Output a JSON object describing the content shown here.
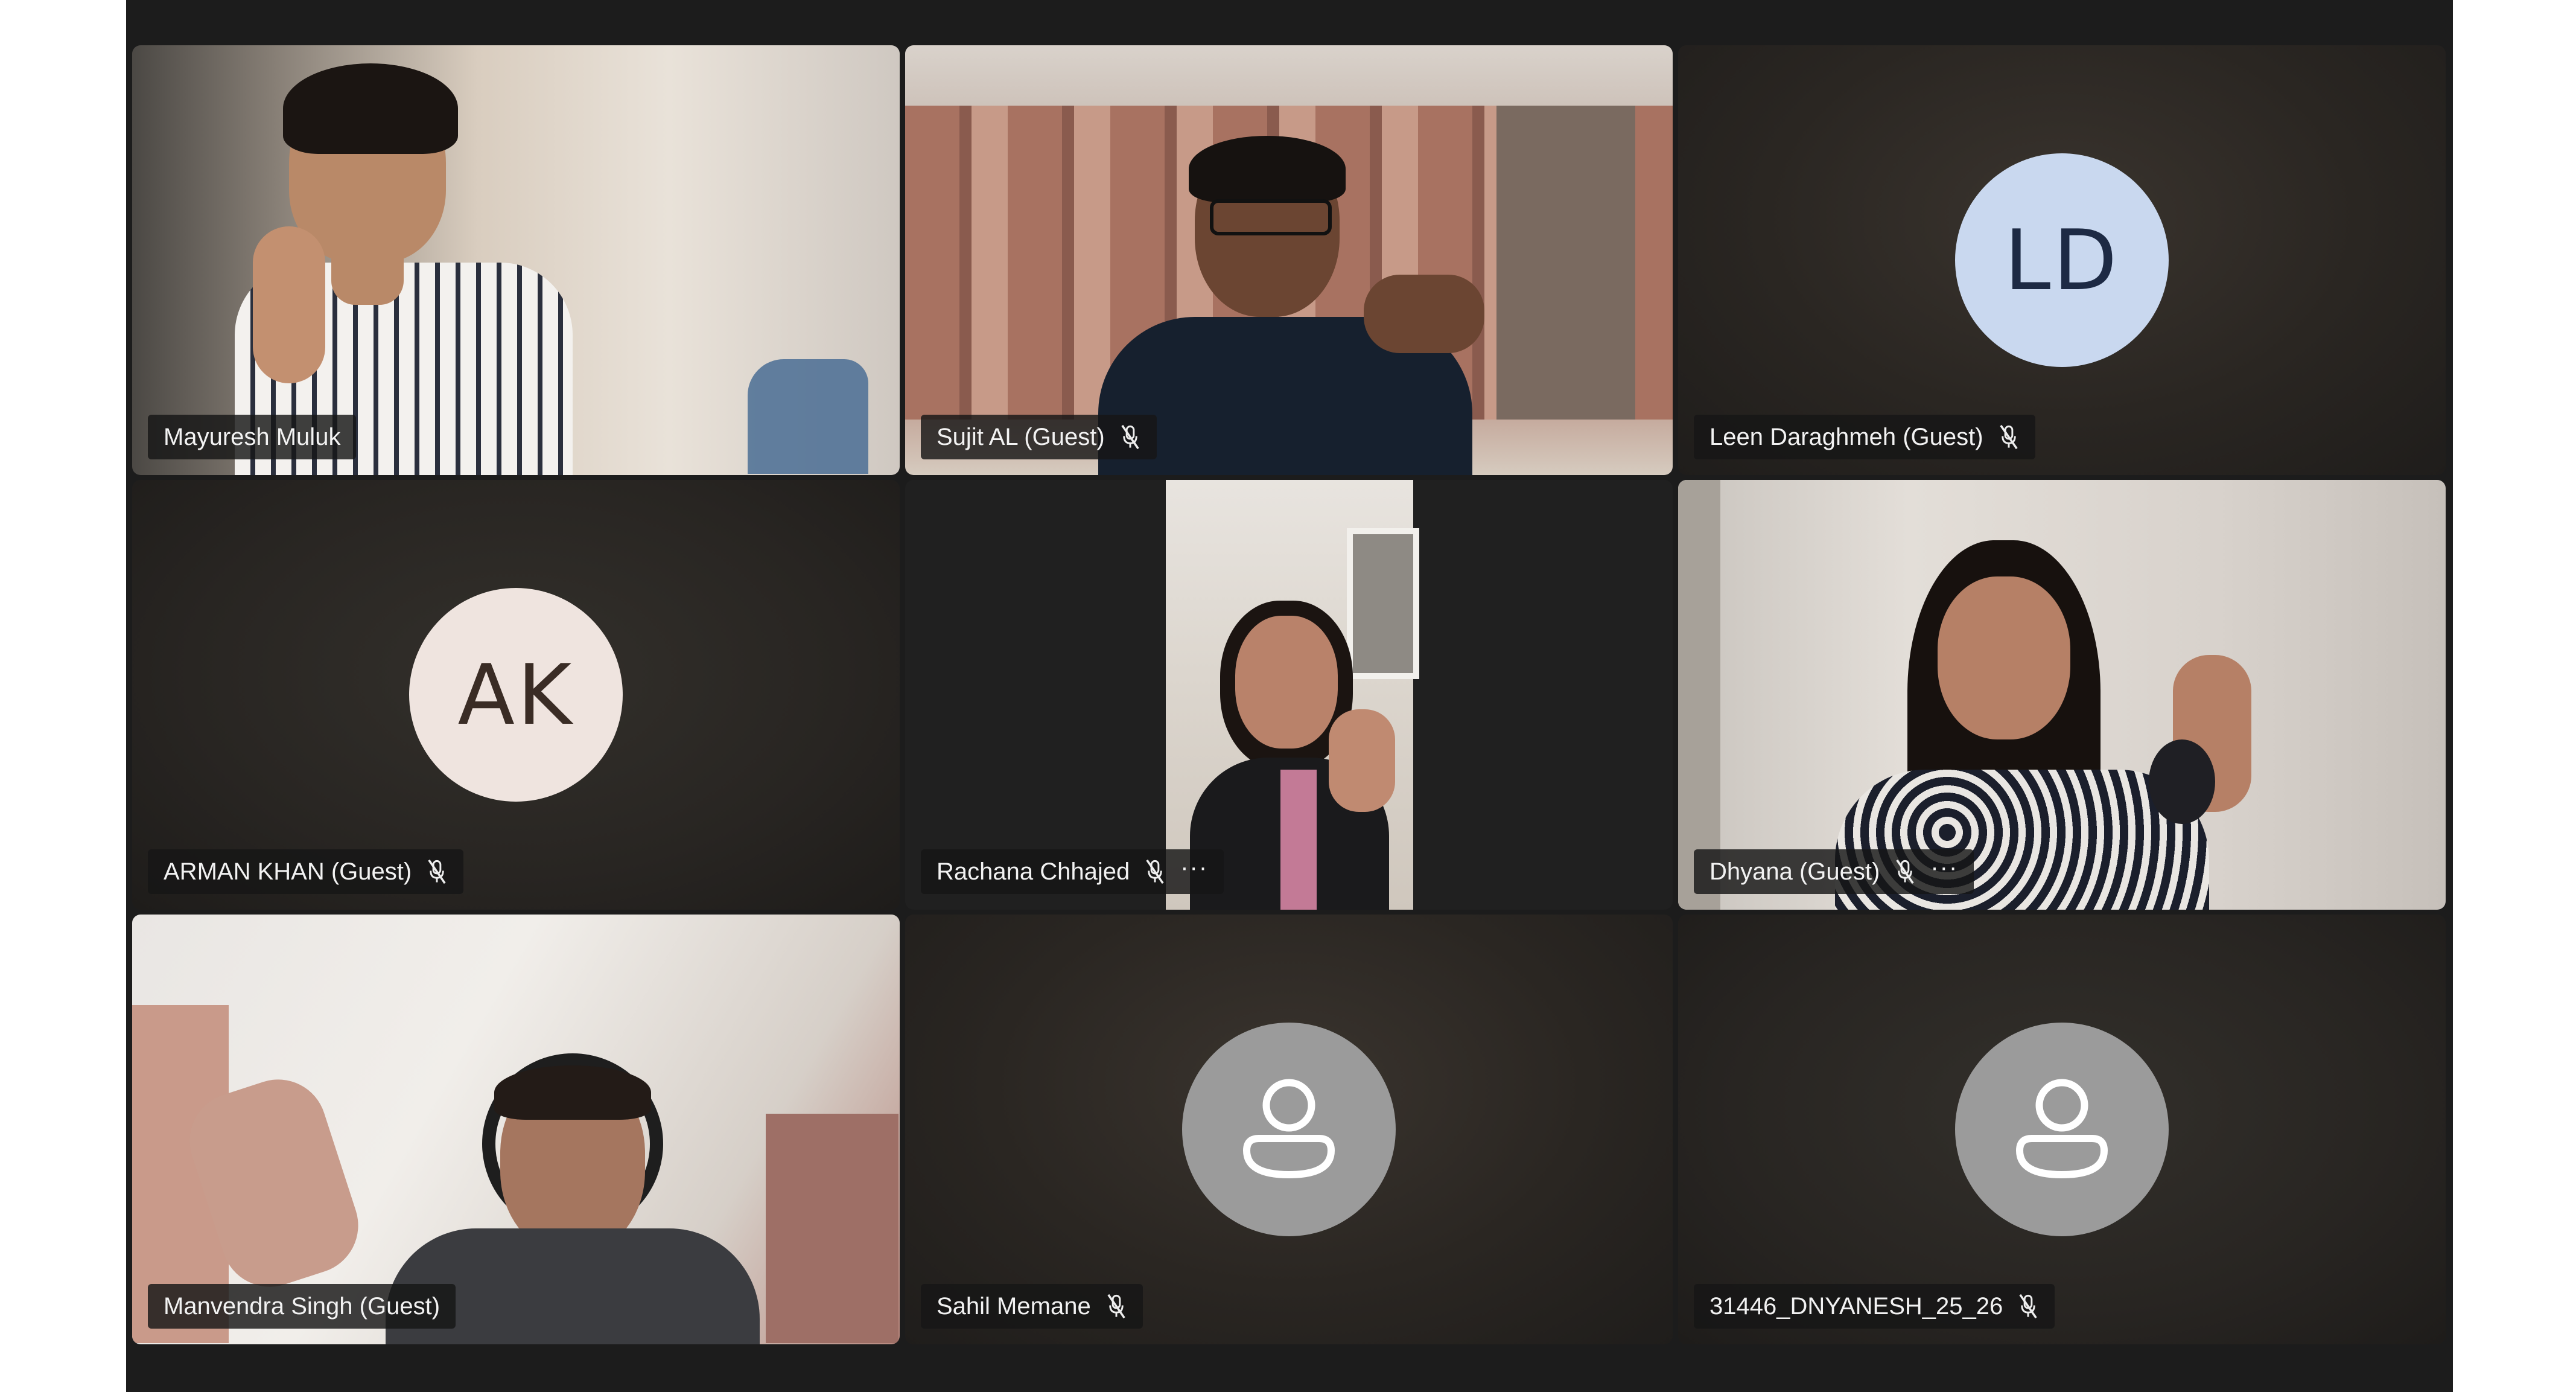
{
  "participants": [
    {
      "name": "Mayuresh Muluk",
      "type": "video",
      "muted": false
    },
    {
      "name": "Sujit AL (Guest)",
      "type": "video",
      "muted": true
    },
    {
      "name": "Leen Daraghmeh (Guest)",
      "type": "initials",
      "initials": "LD",
      "muted": true
    },
    {
      "name": "ARMAN KHAN (Guest)",
      "type": "initials",
      "initials": "AK",
      "muted": true
    },
    {
      "name": "Rachana Chhajed",
      "type": "video",
      "muted": true,
      "more": "···"
    },
    {
      "name": "Dhyana (Guest)",
      "type": "video",
      "muted": true,
      "more": "···"
    },
    {
      "name": "Manvendra Singh (Guest)",
      "type": "video",
      "muted": false
    },
    {
      "name": "Sahil Memane",
      "type": "placeholder",
      "muted": true
    },
    {
      "name": "31446_DNYANESH_25_26",
      "type": "placeholder",
      "muted": true
    }
  ],
  "icons": {
    "muted": "mic-off-icon",
    "placeholder": "person-icon",
    "more": "more-options-icon"
  },
  "colors": {
    "stage": "#1c1c1c",
    "nametag_bg": "#161616",
    "ld_avatar": "#c9d8ef",
    "ak_avatar": "#efe4df",
    "placeholder_avatar": "#9b9b9b"
  }
}
